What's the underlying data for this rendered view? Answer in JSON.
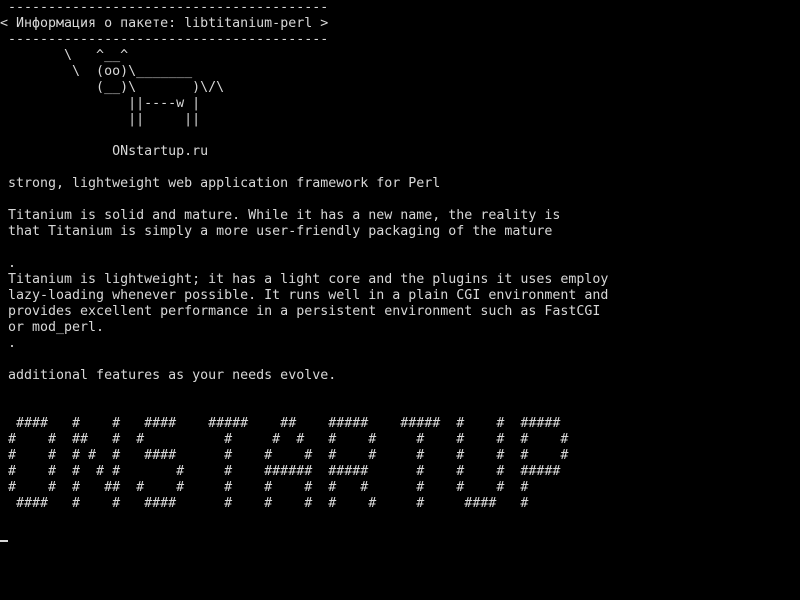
{
  "terminal": {
    "colors": {
      "background": "#000000",
      "foreground": "#d8d8d8"
    },
    "cowsay": {
      "border_top": "----------------------------------------",
      "bubble": "< Информация о пакете: libtitanium-perl >",
      "border_bottom": " ----------------------------------------",
      "cow": [
        "       \\   ^__^",
        "        \\  (oo)\\_______",
        "           (__)\\       )\\/\\",
        "               ||----w |",
        "               ||     ||"
      ],
      "site": "             ONstartup.ru"
    },
    "description": {
      "summary": "strong, lightweight web application framework for Perl",
      "para1": [
        "Titanium is solid and mature. While it has a new name, the reality is",
        "that Titanium is simply a more user-friendly packaging of the mature"
      ],
      "dot1": ".",
      "para2": [
        "Titanium is lightweight; it has a light core and the plugins it uses employ",
        "lazy-loading whenever possible. It runs well in a plain CGI environment and",
        "provides excellent performance in a persistent environment such as FastCGI",
        "or mod_perl."
      ],
      "dot2": ".",
      "para3": "additional features as your needs evolve."
    },
    "banner": [
      " ####   #    #   ####    #####    ##    #####    #####  #    #  #####",
      "#    #  ##   #  #          #     #  #   #    #     #    #    #  #    #",
      "#    #  # #  #   ####      #    #    #  #    #     #    #    #  #    #",
      "#    #  #  # #       #     #    ######  #####      #    #    #  #####",
      "#    #  #   ##  #    #     #    #    #  #   #      #    #    #  #",
      " ####   #    #   ####      #    #    #  #    #     #     ####   #"
    ]
  }
}
